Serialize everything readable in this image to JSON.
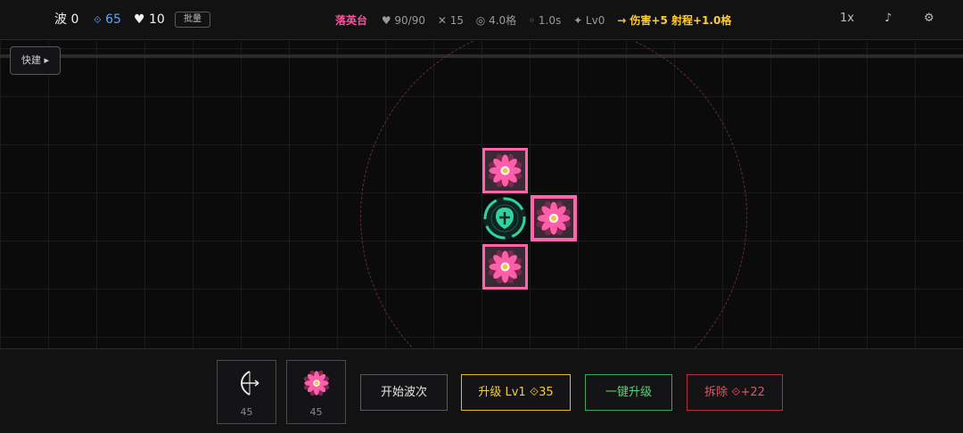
{
  "hud": {
    "wave": "波 0",
    "gold_icon": "⟐",
    "gold": "65",
    "lives": "♥ 10",
    "batch_label": "批量"
  },
  "selected_tower": {
    "name": "落英台",
    "hp": "♥ 90/90",
    "damage": "✕ 15",
    "range": "◎ 4.0格",
    "cooldown": "◦ 1.0s",
    "level": "✦ Lv0",
    "upgrade_preview": "→ 伤害+5 射程+1.0格"
  },
  "controls": {
    "speed": "1x",
    "music_icon": "♪",
    "settings_icon": "⚙"
  },
  "field": {
    "quick_build_label": "快建 ▸",
    "towers": [
      {
        "type": "flower-tower",
        "cell": "top"
      },
      {
        "type": "flower-tower",
        "cell": "right",
        "selected": true
      },
      {
        "type": "flower-tower",
        "cell": "bottom"
      }
    ],
    "core": {
      "type": "core-base"
    }
  },
  "build_cards": [
    {
      "icon": "bow-icon",
      "cost": "45"
    },
    {
      "icon": "flower-icon",
      "cost": "45"
    }
  ],
  "actions": {
    "start_wave": "开始波次",
    "upgrade": "升级 Lv1 ⟐35",
    "upgrade_all": "一键升级",
    "sell": "拆除 ⟐+22"
  },
  "colors": {
    "accent_pink": "#ff66aa",
    "gold_blue": "#5aa7ff",
    "upgrade_yellow": "#e5b92b",
    "upgrade_all_green": "#3fa35a",
    "sell_red": "#b0303f",
    "core_teal": "#2fd3a0"
  }
}
